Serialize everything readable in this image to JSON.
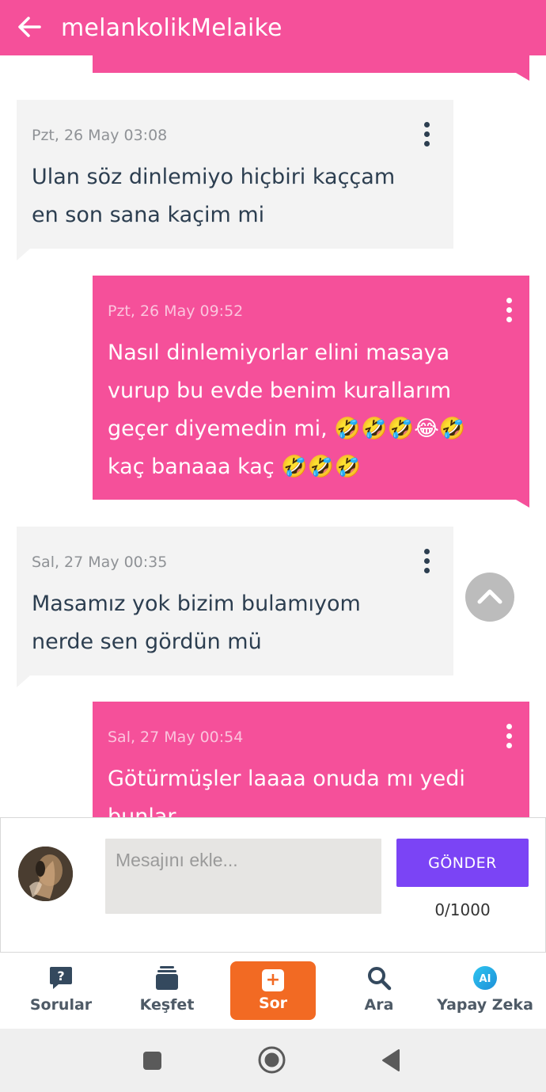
{
  "header": {
    "title": "melankolikMelaike",
    "background_color": "#f5509a",
    "back_icon": "arrow-left-icon"
  },
  "messages": [
    {
      "direction": "received",
      "time": "Pzt, 26 May 03:08",
      "text": "Ulan söz dinlemiyo hiçbiri kaççam en son sana kaçim mi"
    },
    {
      "direction": "sent",
      "time": "Pzt, 26 May 09:52",
      "text": "Nasıl dinlemiyorlar elini masaya vurup bu evde benim kurallarım geçer diyemedin mi, 🤣🤣🤣😂🤣 kaç banaaa kaç 🤣🤣🤣"
    },
    {
      "direction": "received",
      "time": "Sal, 27 May 00:35",
      "text": "Masamız yok bizim bulamıyom nerde sen gördün mü"
    },
    {
      "direction": "sent",
      "time": "Sal, 27 May 00:54",
      "text": "Götürmüşler laaaa onuda mı yedi bunlar"
    }
  ],
  "composer": {
    "placeholder": "Mesajını ekle...",
    "value": "",
    "send_label": "GÖNDER",
    "char_count": "0/1000",
    "send_color": "#7b44f5"
  },
  "bottom_nav": {
    "items": [
      {
        "label": "Sorular",
        "icon": "question-bubble-icon"
      },
      {
        "label": "Keşfet",
        "icon": "cards-stack-icon"
      },
      {
        "label": "Sor",
        "icon": "plus-box-icon",
        "active": true
      },
      {
        "label": "Ara",
        "icon": "search-icon"
      },
      {
        "label": "Yapay Zeka",
        "icon": "ai-icon"
      }
    ],
    "sor_icon_glyph": "+",
    "ai_icon_text": "AI",
    "active_color": "#f26a23"
  },
  "system_nav": {
    "buttons": [
      "recent-apps-icon",
      "home-icon",
      "back-triangle-icon"
    ]
  },
  "colors": {
    "sent_bubble": "#f5509a",
    "received_bubble": "#f3f3f3",
    "text_dark": "#2c3e50"
  }
}
